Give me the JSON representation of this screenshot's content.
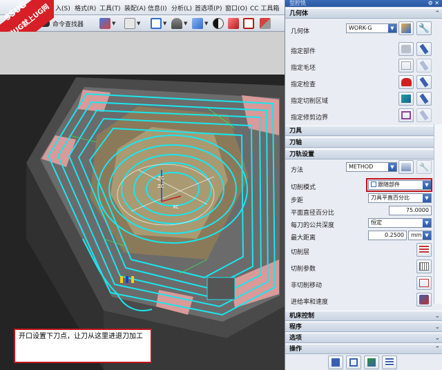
{
  "menubar": {
    "items": [
      "入(S)",
      "格式(R)",
      "工具(T)",
      "装配(A)",
      "信息(I)",
      "分析(L)",
      "首选项(P)",
      "窗口(O)",
      "CC 工具箱"
    ]
  },
  "toolbar": {
    "command_finder_label": "命令查找器"
  },
  "brand": {
    "line1": "9SUG",
    "line2": "学UG就上UG网"
  },
  "viewport": {
    "axis_z1": "ZC",
    "axis_z2": "ZC",
    "axis_x": "XC",
    "callout_text": "开口设置下刀点，让刀从这里进退刀加工"
  },
  "dialog": {
    "title": "型腔铣",
    "sections": {
      "geometry": "几何体",
      "tool": "刀具",
      "axis": "刀轴",
      "path_settings": "刀轨设置",
      "machine_control": "机床控制",
      "program": "程序",
      "options": "选项",
      "actions": "操作"
    },
    "geometry": {
      "label": "几何体",
      "value": "WORK-G",
      "specify_part": "指定部件",
      "specify_blank": "指定毛坯",
      "specify_check": "指定检查",
      "specify_cut_area": "指定切削区域",
      "specify_trim": "指定修剪边界"
    },
    "path": {
      "method_label": "方法",
      "method_value": "METHOD",
      "cut_pattern_label": "切削模式",
      "cut_pattern_value": "跟随部件",
      "stepover_label": "步距",
      "stepover_value": "刀具平直百分比",
      "flat_percent_label": "平面直径百分比",
      "flat_percent_value": "75.0000",
      "common_depth_label": "每刀的公共深度",
      "common_depth_value": "恒定",
      "max_distance_label": "最大距离",
      "max_distance_value": "0.2500",
      "max_distance_unit": "mm",
      "cut_levels": "切削层",
      "cut_params": "切削参数",
      "non_cut_moves": "非切削移动",
      "feeds_speeds": "进给率和速度"
    }
  },
  "colors": {
    "toolpath": "#19e6f0",
    "highlight": "#c0141c",
    "dialog_bg": "#e9edf3"
  }
}
